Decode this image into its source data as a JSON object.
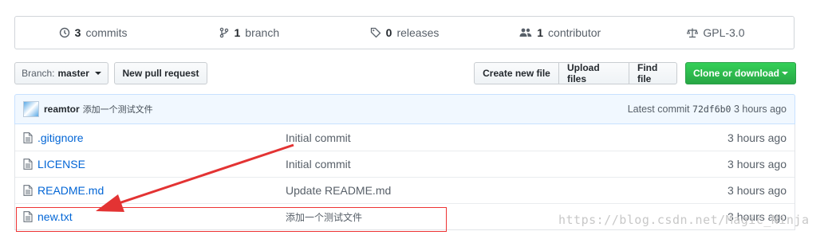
{
  "stats": {
    "commits": {
      "count": "3",
      "label": "commits"
    },
    "branches": {
      "count": "1",
      "label": "branch"
    },
    "releases": {
      "count": "0",
      "label": "releases"
    },
    "contributors": {
      "count": "1",
      "label": "contributor"
    },
    "license": {
      "label": "GPL-3.0"
    }
  },
  "toolbar": {
    "branch_prefix": "Branch:",
    "branch_name": "master",
    "new_pull_request": "New pull request",
    "create_new_file": "Create new file",
    "upload_files": "Upload files",
    "find_file": "Find file",
    "clone_or_download": "Clone or download"
  },
  "latest_commit": {
    "author": "reamtor",
    "message": "添加一个测试文件",
    "prefix": "Latest commit",
    "sha": "72df6b0",
    "age": "3 hours ago"
  },
  "files": [
    {
      "name": ".gitignore",
      "message": "Initial commit",
      "age": "3 hours ago"
    },
    {
      "name": "LICENSE",
      "message": "Initial commit",
      "age": "3 hours ago"
    },
    {
      "name": "README.md",
      "message": "Update README.md",
      "age": "3 hours ago"
    },
    {
      "name": "new.txt",
      "message": "添加一个测试文件",
      "age": "3 hours ago"
    }
  ],
  "watermark": "https://blog.csdn.net/Magic_Ninja",
  "colors": {
    "link": "#0366d6",
    "green": "#28a745",
    "annotation_red": "#e33333"
  }
}
